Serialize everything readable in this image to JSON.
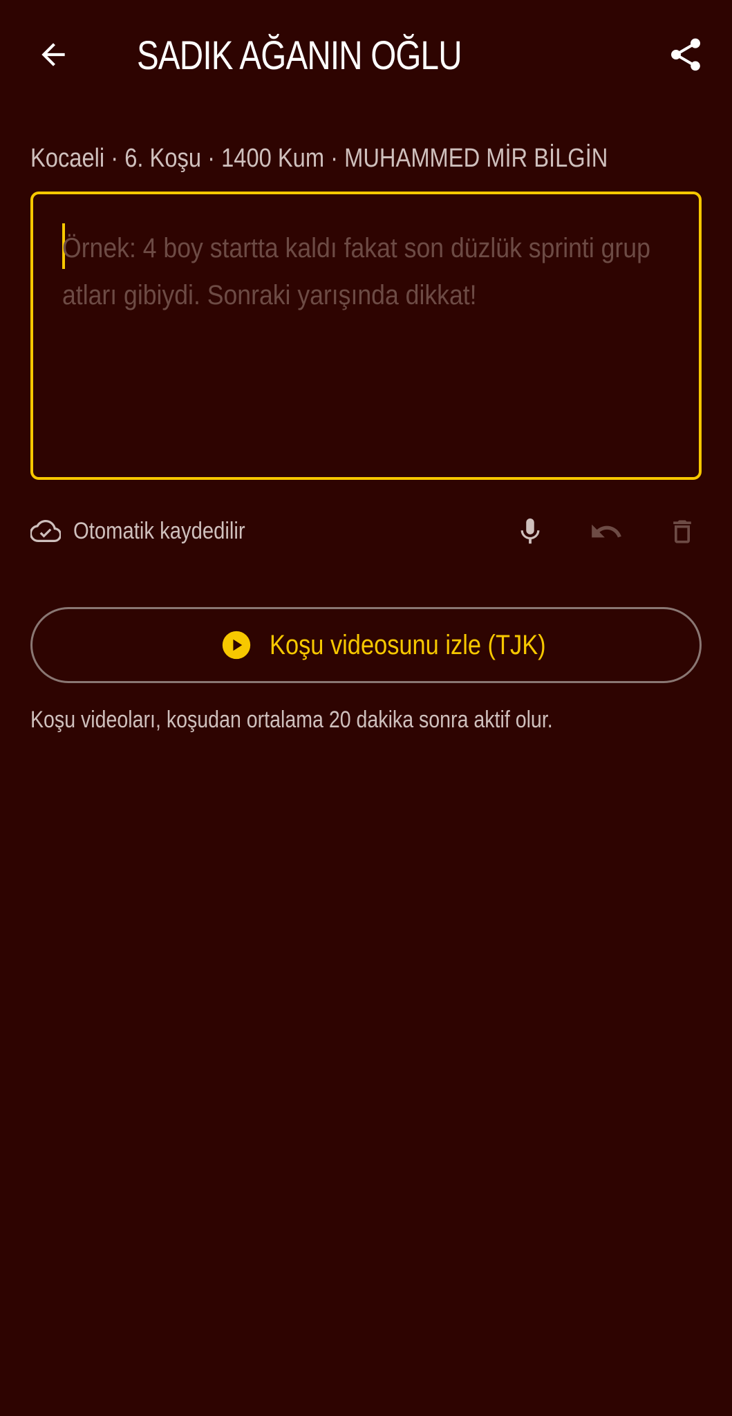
{
  "header": {
    "title": "SADIK AĞANIN OĞLU",
    "back_icon": "arrow-left-icon",
    "share_icon": "share-icon"
  },
  "race_info": "Kocaeli · 6. Koşu · 1400 Kum · MUHAMMED MİR BİLGİN",
  "note": {
    "value": "",
    "placeholder": "Örnek: 4 boy startta kaldı fakat son düzlük sprinti grup atları gibiydi. Sonraki yarışında dikkat!"
  },
  "status": {
    "autosave_label": "Otomatik kaydedilir",
    "icons": [
      "cloud-check-icon",
      "microphone-icon",
      "undo-icon",
      "trash-icon"
    ]
  },
  "video": {
    "button_label": "Koşu videosunu izle (TJK)",
    "note": "Koşu videoları, koşudan ortalama 20 dakika sonra aktif olur."
  },
  "colors": {
    "background": "#2e0401",
    "accent": "#f7c800",
    "text": "#ffffff",
    "muted_text": "#cfc0bd",
    "placeholder": "#6d4b45"
  }
}
